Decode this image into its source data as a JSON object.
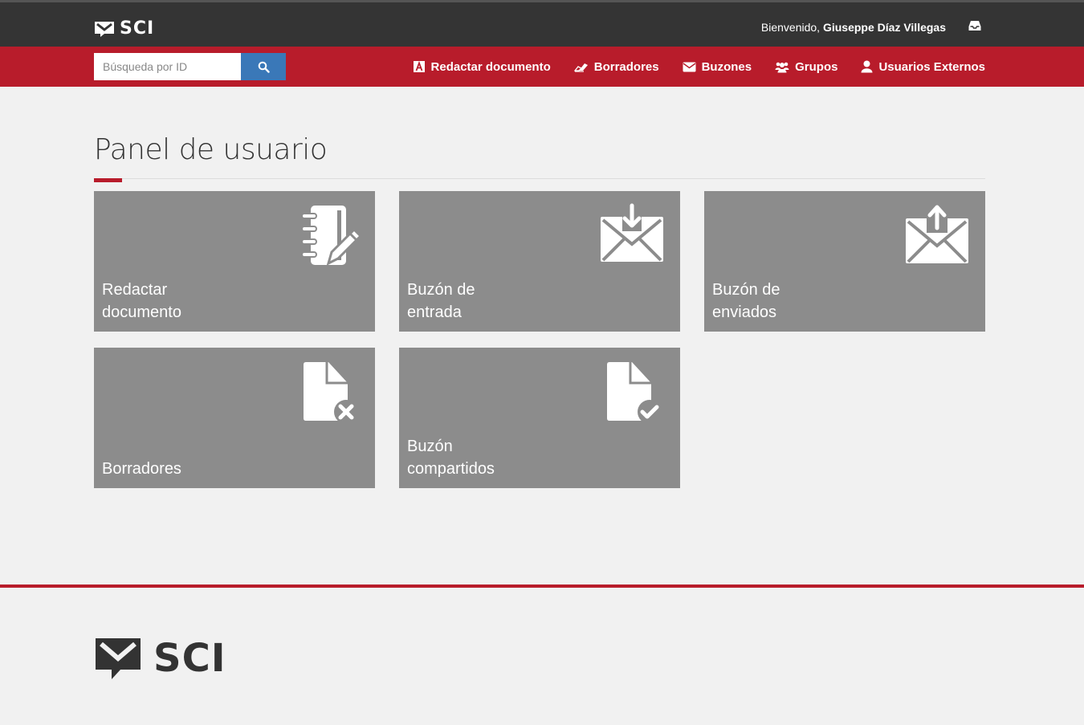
{
  "header": {
    "brand": "SCI",
    "welcome_prefix": "Bienvenido,",
    "user_name": "Giuseppe Díaz Villegas"
  },
  "navbar": {
    "search_placeholder": "Búsqueda por ID",
    "links": [
      {
        "label": "Redactar documento",
        "icon": "document-a-icon"
      },
      {
        "label": "Borradores",
        "icon": "eraser-icon"
      },
      {
        "label": "Buzones",
        "icon": "envelope-icon"
      },
      {
        "label": "Grupos",
        "icon": "users-group-icon"
      },
      {
        "label": "Usuarios Externos",
        "icon": "user-icon"
      }
    ]
  },
  "main": {
    "title": "Panel de usuario",
    "tiles": [
      {
        "line1": "Redactar",
        "line2": "documento",
        "icon": "notebook-pencil-icon"
      },
      {
        "line1": "Buzón de",
        "line2": "entrada",
        "icon": "envelope-download-icon"
      },
      {
        "line1": "Buzón de",
        "line2": "enviados",
        "icon": "envelope-upload-icon"
      },
      {
        "line1": "",
        "line2": "Borradores",
        "icon": "file-x-icon"
      },
      {
        "line1": "Buzón",
        "line2": "compartidos",
        "icon": "file-check-icon"
      }
    ]
  },
  "footer": {
    "brand": "SCI"
  },
  "colors": {
    "topbar": "#343434",
    "navbar": "#b81c2b",
    "tile": "#8c8c8c",
    "search_button": "#3a78b8"
  }
}
